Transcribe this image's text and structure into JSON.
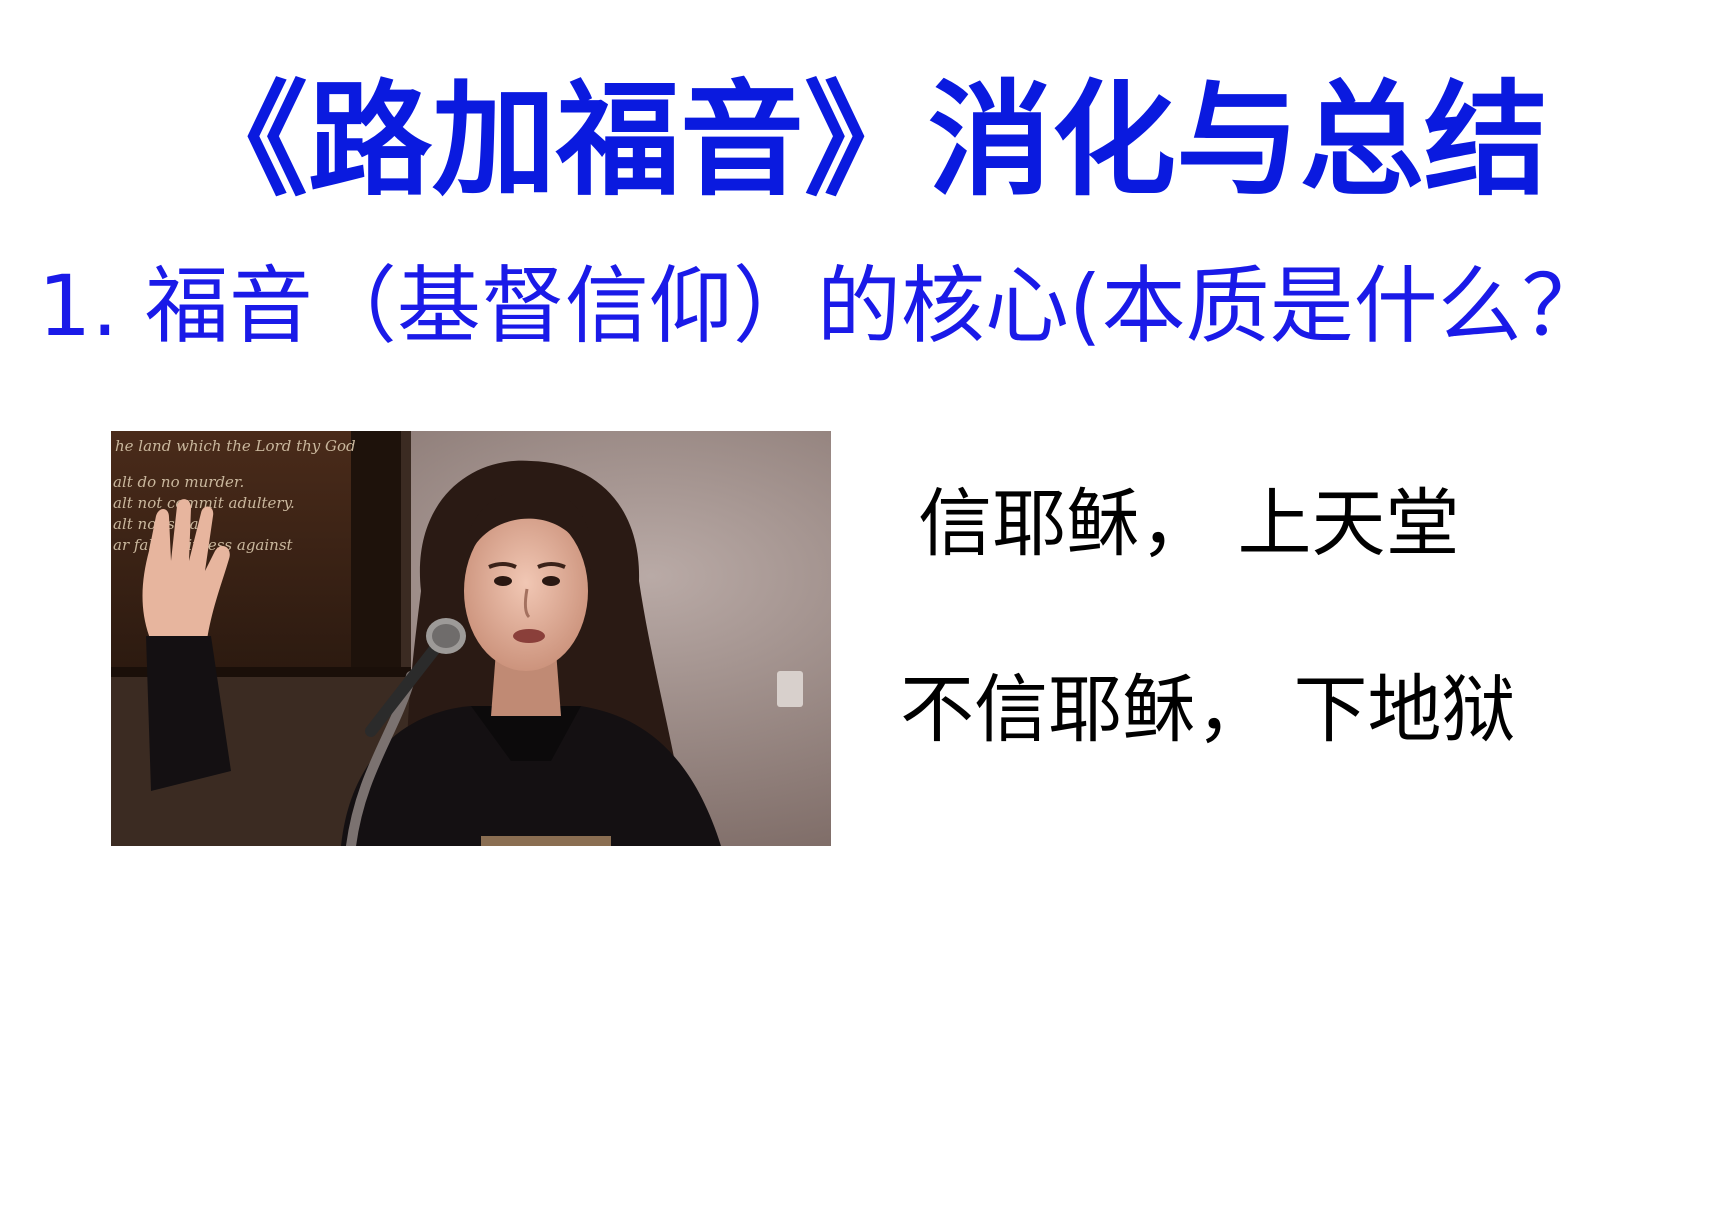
{
  "slide": {
    "title": "《路加福音》消化与总结",
    "subtitle": "1. 福音（基督信仰）的核心(本质是什么？",
    "statements": [
      "信耶稣，  上天堂",
      "不信耶稣，  下地狱"
    ]
  },
  "photo": {
    "subject": "woman-speaking-at-microphone",
    "sign_text": [
      "he land which the Lord thy God",
      "alt do no murder.",
      "alt not commit adultery.",
      "alt not steal.",
      "ar false witness against"
    ]
  },
  "colors": {
    "title": "#0a1adf",
    "subtitle": "#1a1ae8",
    "statement": "#000000",
    "background": "#ffffff"
  }
}
